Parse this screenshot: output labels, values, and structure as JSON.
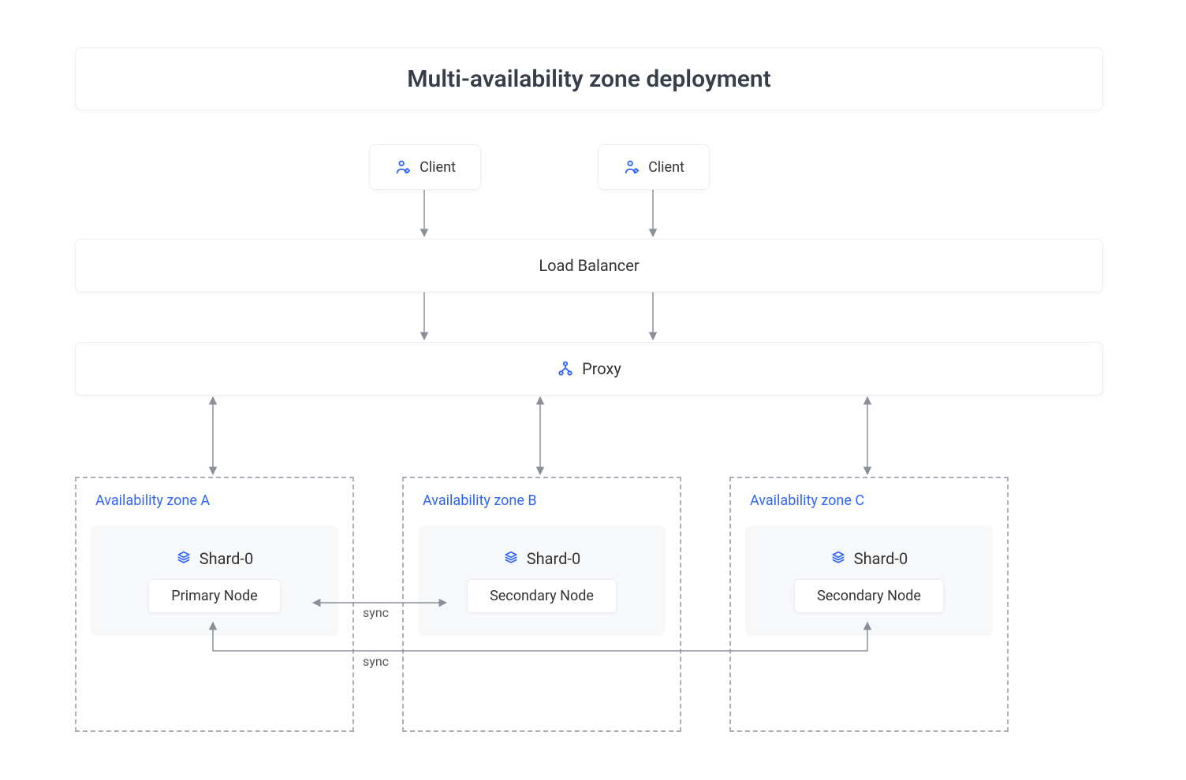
{
  "title": "Multi-availability zone deployment",
  "client_left": "Client",
  "client_right": "Client",
  "load_balancer": "Load Balancer",
  "proxy": "Proxy",
  "az": {
    "a": {
      "label": "Availability zone A",
      "shard": "Shard-0",
      "node": "Primary Node"
    },
    "b": {
      "label": "Availability zone B",
      "shard": "Shard-0",
      "node": "Secondary Node"
    },
    "c": {
      "label": "Availability zone C",
      "shard": "Shard-0",
      "node": "Secondary Node"
    }
  },
  "sync1": "sync",
  "sync2": "sync",
  "colors": {
    "accent": "#2e64ff",
    "arrow": "#8a8f9a"
  }
}
